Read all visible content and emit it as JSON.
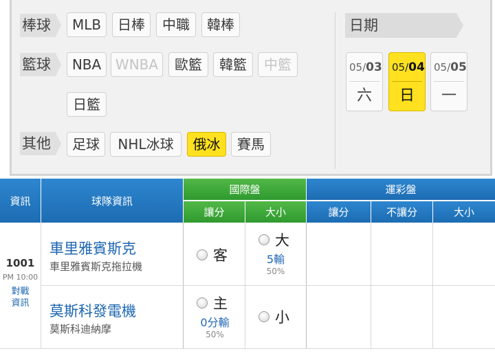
{
  "filters": {
    "baseball": {
      "label": "棒球",
      "items": [
        "MLB",
        "日棒",
        "中職",
        "韓棒"
      ]
    },
    "basketball": {
      "label": "籃球",
      "items": [
        "NBA",
        "WNBA",
        "歐籃",
        "韓籃",
        "中籃",
        "日籃"
      ]
    },
    "other": {
      "label": "其他",
      "items": [
        "足球",
        "NHL冰球",
        "俄冰",
        "賽馬"
      ]
    },
    "active_item": "俄冰",
    "disabled_items": [
      "WNBA",
      "中籃"
    ]
  },
  "dates": {
    "label": "日期",
    "items": [
      {
        "month": "05/",
        "day": "03",
        "weekday": "六"
      },
      {
        "month": "05/",
        "day": "04",
        "weekday": "日",
        "selected": true
      },
      {
        "month": "05/",
        "day": "05",
        "weekday": "一"
      }
    ]
  },
  "table": {
    "headers": {
      "info": "資訊",
      "team_info": "球隊資訊",
      "intl": "國際盤",
      "sports_lottery": "運彩盤",
      "handicap": "讓分",
      "over_under": "大小",
      "no_handicap": "不讓分"
    },
    "game": {
      "number": "1001",
      "time": "PM 10:00",
      "matchup_link_line1": "對戰",
      "matchup_link_line2": "資訊",
      "away": {
        "name": "車里雅賓斯克",
        "sub": "車里雅賓斯克拖拉機",
        "handicap": {
          "label": "客"
        },
        "total": {
          "label": "大",
          "odds": "5輸",
          "pct": "50%"
        }
      },
      "home": {
        "name": "莫斯科發電機",
        "sub": "莫斯科迪納摩",
        "handicap": {
          "label": "主",
          "odds": "0分輸",
          "pct": "50%"
        },
        "total": {
          "label": "小"
        }
      }
    }
  },
  "colors": {
    "accent_yellow": "#ffe11f",
    "header_blue": "#1c6cb2",
    "header_green": "#2f9a2f",
    "team_blue": "#1d66b0"
  }
}
